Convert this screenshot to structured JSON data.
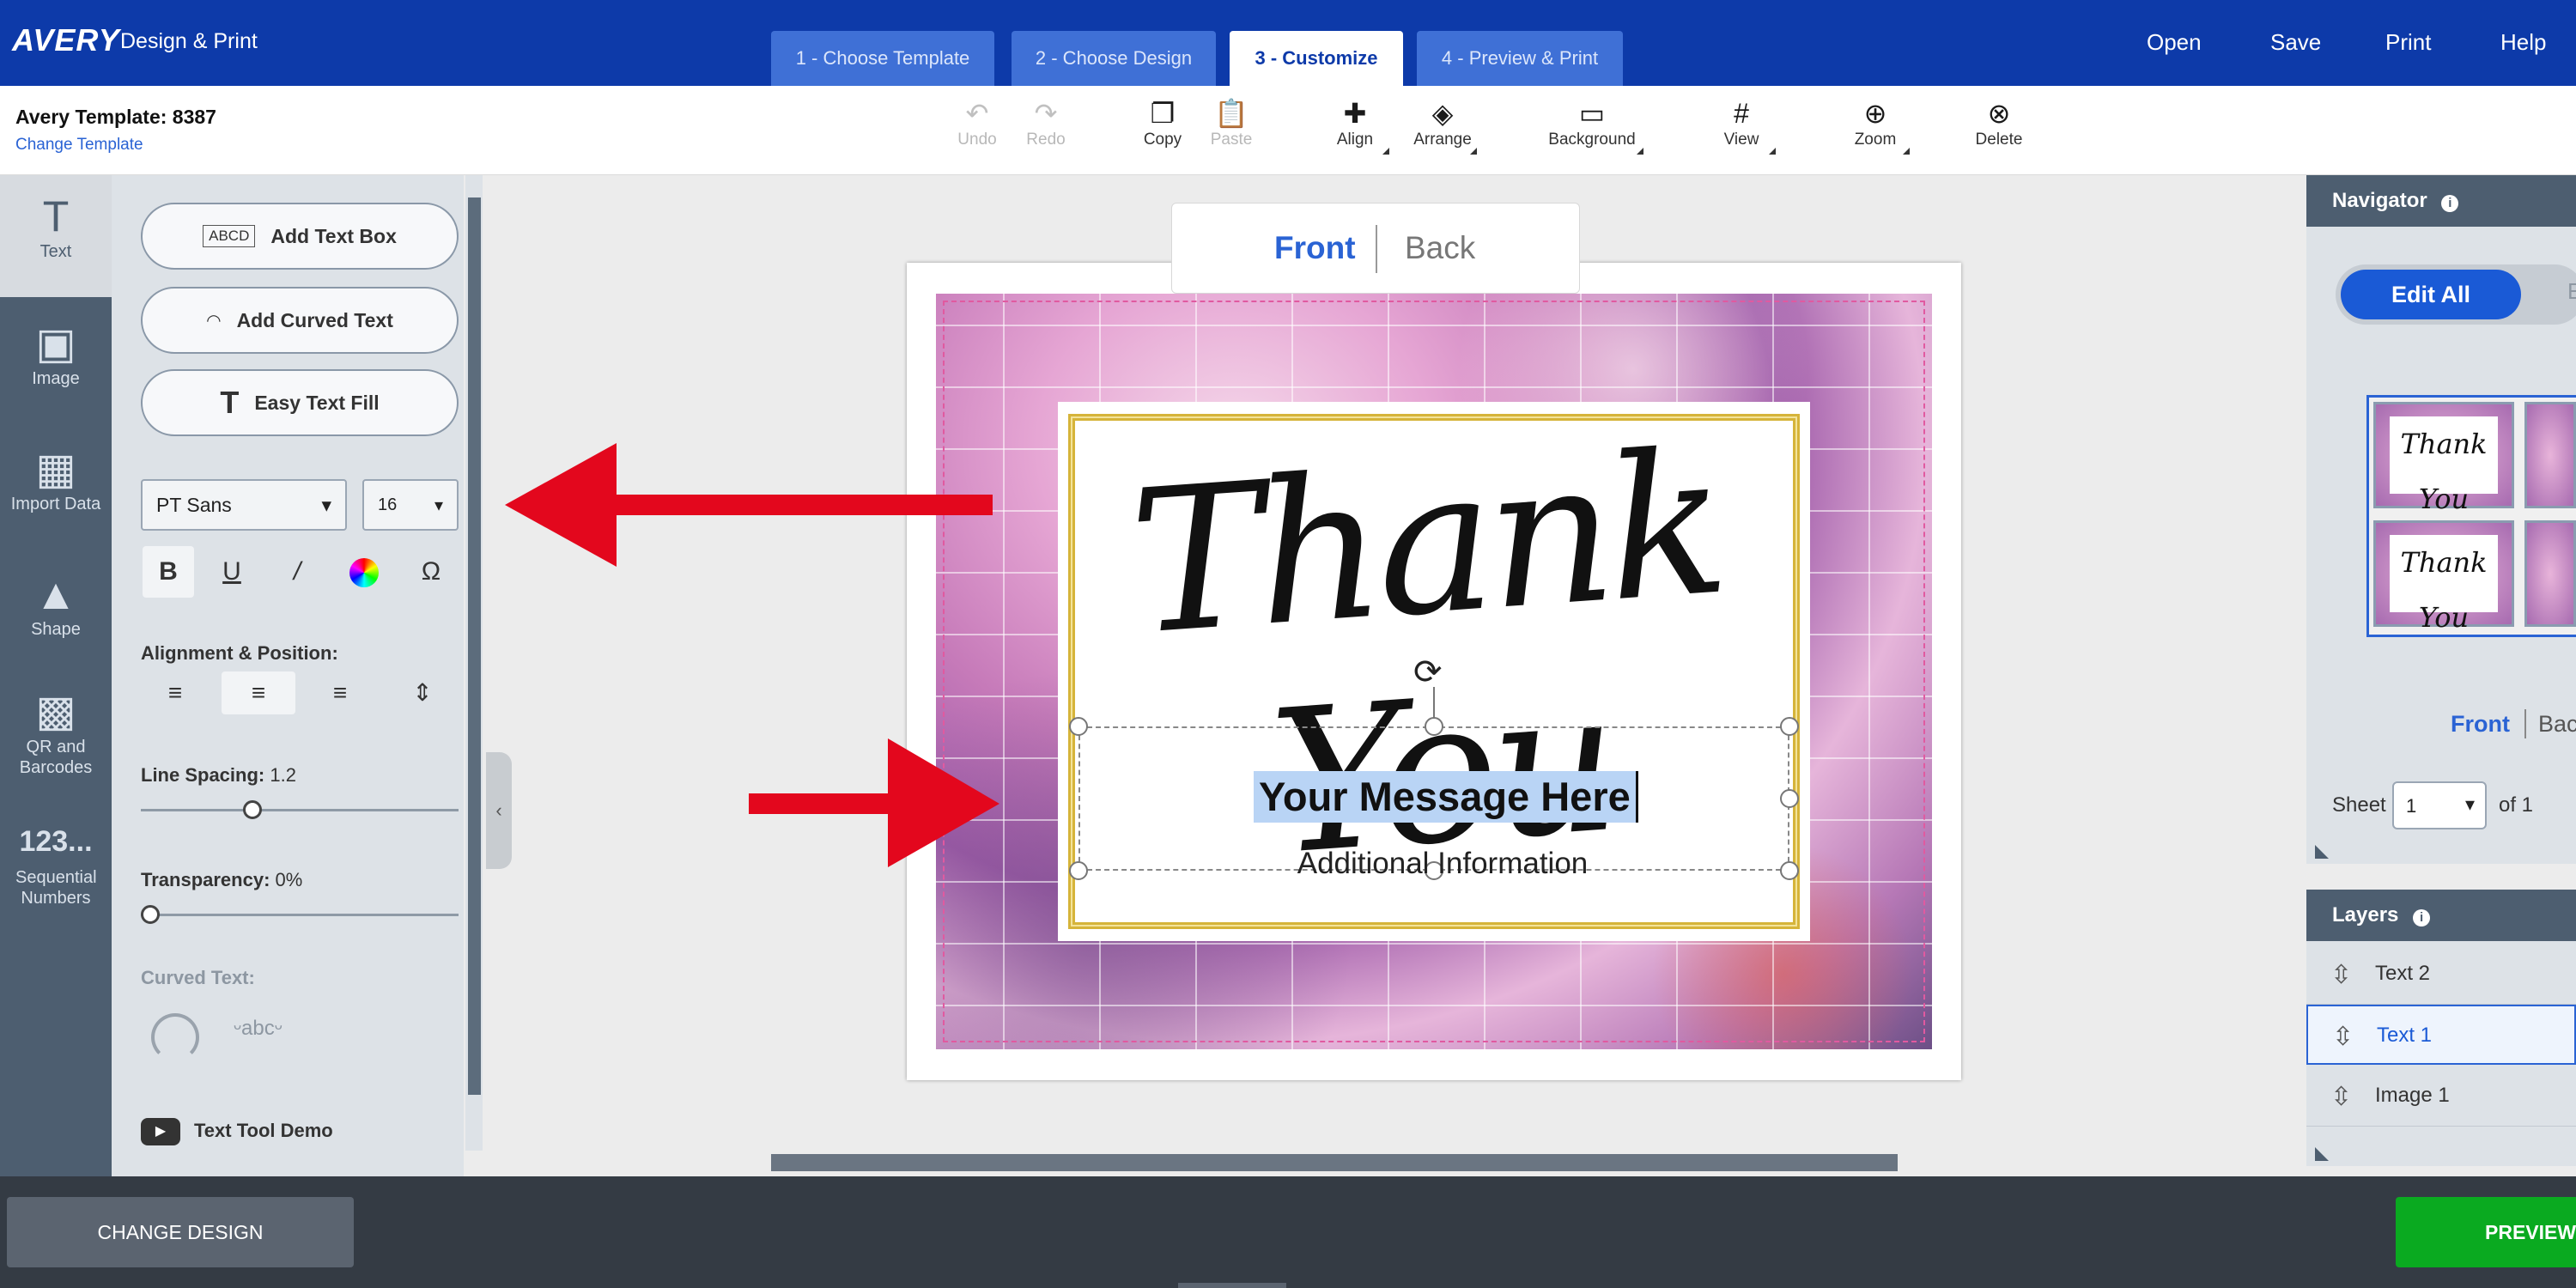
{
  "header": {
    "logo": "AVERY",
    "product": "Design & Print",
    "steps": [
      {
        "label": "1 - Choose Template"
      },
      {
        "label": "2 - Choose Design"
      },
      {
        "label": "3 - Customize"
      },
      {
        "label": "4 - Preview & Print"
      }
    ],
    "actions": {
      "open": "Open",
      "save": "Save",
      "print": "Print",
      "help": "Help"
    }
  },
  "template": {
    "title": "Avery Template: 8387",
    "change_link": "Change Template"
  },
  "toolbar": {
    "undo": "Undo",
    "redo": "Redo",
    "copy": "Copy",
    "paste": "Paste",
    "align": "Align",
    "arrange": "Arrange",
    "background": "Background",
    "view": "View",
    "zoom": "Zoom",
    "delete": "Delete"
  },
  "sidebar": {
    "items": [
      {
        "label": "Text",
        "icon": "text-icon"
      },
      {
        "label": "Image",
        "icon": "image-icon"
      },
      {
        "label": "Import Data",
        "icon": "table-icon"
      },
      {
        "label": "Shape",
        "icon": "shape-icon"
      },
      {
        "label": "QR and Barcodes",
        "icon": "qr-icon"
      },
      {
        "label": "Sequential Numbers",
        "icon": "numbers-icon"
      }
    ]
  },
  "text_panel": {
    "add_text_box": "Add Text Box",
    "add_text_box_icon": "ABCD",
    "add_curved_text": "Add Curved Text",
    "easy_text_fill": "Easy Text Fill",
    "font": "PT Sans",
    "font_size": "16",
    "alignment_label": "Alignment & Position:",
    "line_spacing_label": "Line Spacing:",
    "line_spacing": "1.2",
    "line_spacing_fraction": 0.35,
    "transparency_label": "Transparency:",
    "transparency": "0%",
    "transparency_fraction": 0.0,
    "curved_text_label": "Curved Text:",
    "demo_link": "Text Tool Demo"
  },
  "canvas": {
    "front": "Front",
    "back": "Back",
    "title_text": "Thank You",
    "message": "Your Message Here",
    "additional": "Additional Information"
  },
  "navigator": {
    "title": "Navigator",
    "edit_all": "Edit All",
    "front": "Front",
    "back": "Back",
    "sheet_label": "Sheet",
    "sheet_value": "1",
    "sheet_of": "of 1",
    "thumb_text": "Thank You"
  },
  "layers": {
    "title": "Layers",
    "items": [
      {
        "label": "Text 2"
      },
      {
        "label": "Text 1"
      },
      {
        "label": "Image 1"
      }
    ]
  },
  "footer": {
    "change_design": "CHANGE DESIGN",
    "preview": "PREVIEW"
  },
  "colors": {
    "brand": "#0d3aa9",
    "accent": "#1a5ad6",
    "arrow": "#e3071d",
    "preview": "#0aaa20"
  }
}
